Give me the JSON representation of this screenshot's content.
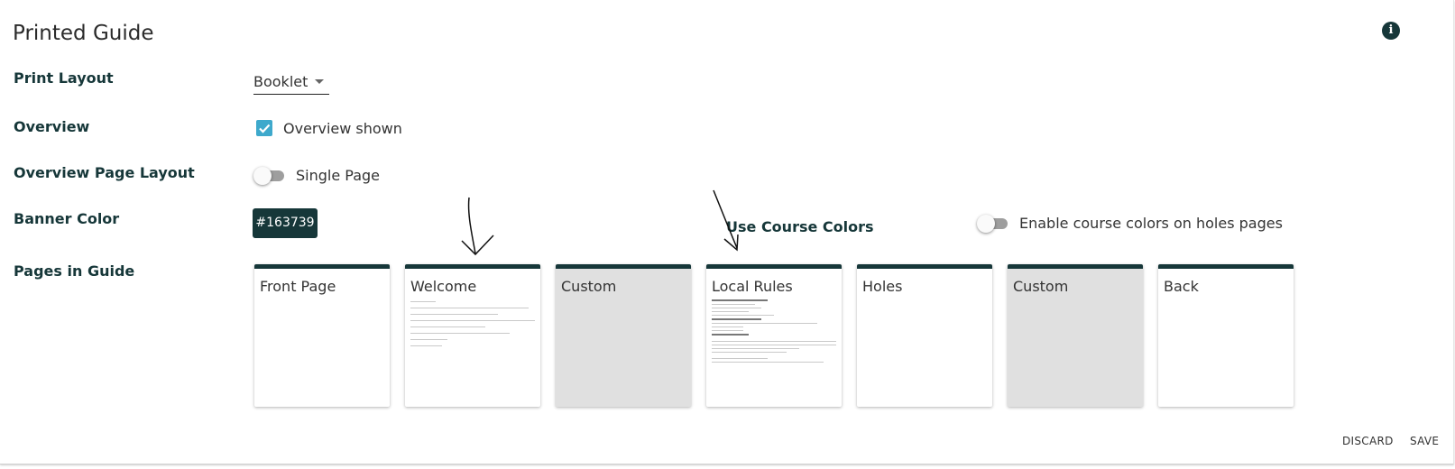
{
  "title": "Printed Guide",
  "info_icon": "info-icon",
  "rows": {
    "print_layout": {
      "label": "Print Layout",
      "value": "Booklet"
    },
    "overview": {
      "label": "Overview",
      "checkbox_label": "Overview shown",
      "checked": true
    },
    "overview_page_layout": {
      "label": "Overview Page Layout",
      "toggle_label": "Single Page",
      "toggle_on": false
    },
    "banner_color": {
      "label": "Banner Color",
      "value": "#163739"
    },
    "use_course_colors": {
      "label": "Use Course Colors",
      "toggle_label": "Enable course colors on holes pages",
      "toggle_on": false
    },
    "pages_in_guide": {
      "label": "Pages in Guide"
    }
  },
  "pages": [
    {
      "title": "Front Page",
      "type": "blank"
    },
    {
      "title": "Welcome",
      "type": "text"
    },
    {
      "title": "Custom",
      "type": "custom"
    },
    {
      "title": "Local Rules",
      "type": "text"
    },
    {
      "title": "Holes",
      "type": "blank"
    },
    {
      "title": "Custom",
      "type": "custom"
    },
    {
      "title": "Back",
      "type": "blank"
    }
  ],
  "actions": {
    "discard": "DISCARD",
    "save": "SAVE"
  },
  "colors": {
    "banner": "#163739",
    "checkbox": "#3ea9cc",
    "custom_page_bg": "#e0e0e0"
  }
}
